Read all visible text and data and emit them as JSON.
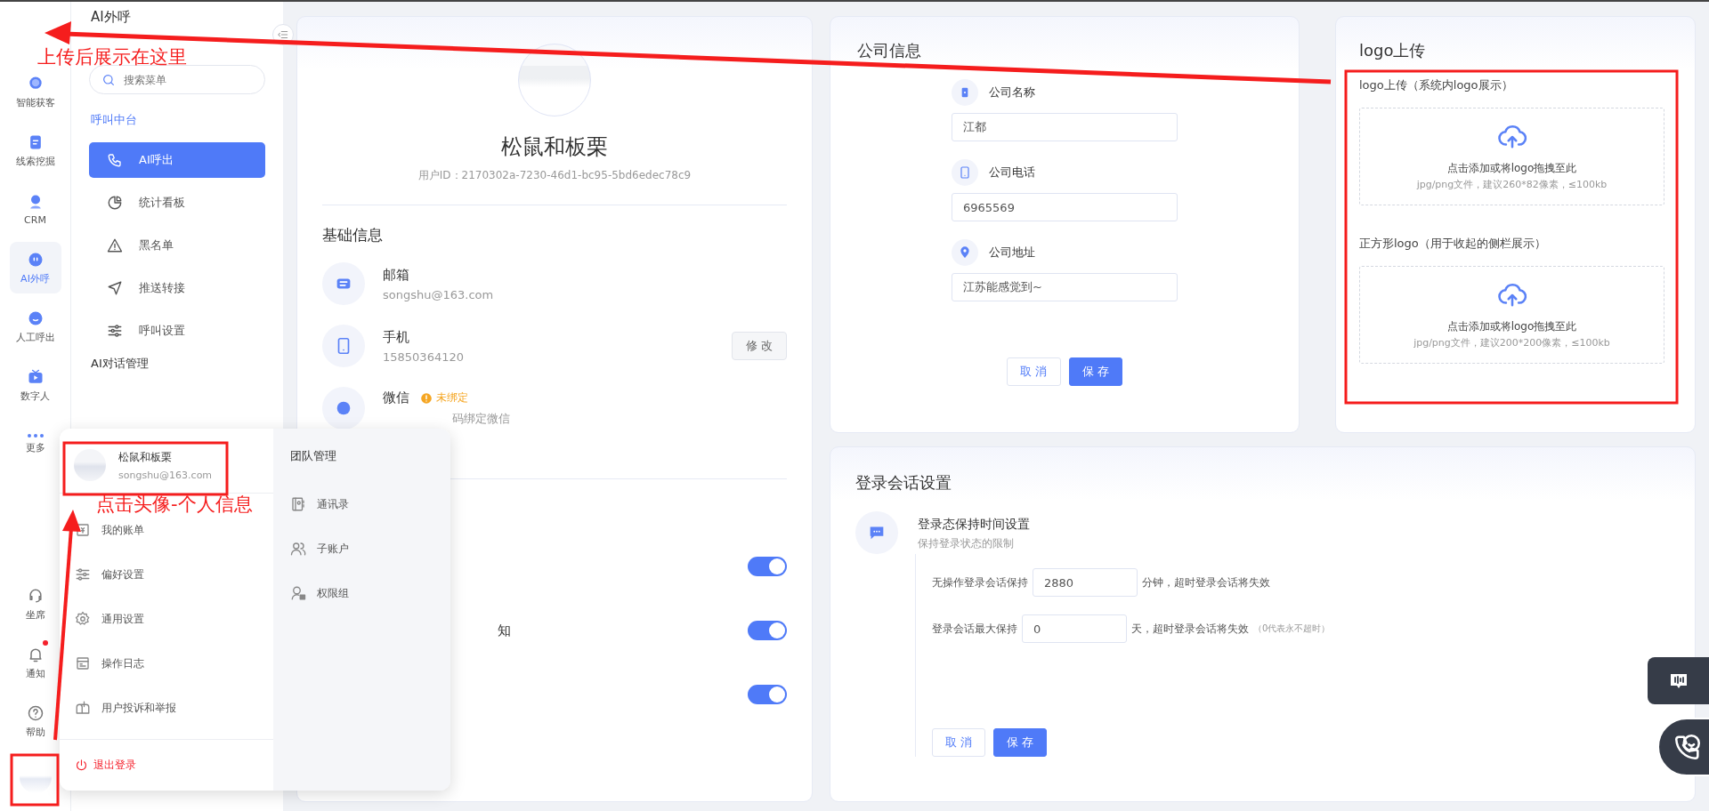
{
  "nav": {
    "items": [
      {
        "label": "智能获客",
        "selected": false
      },
      {
        "label": "线索挖掘",
        "selected": false
      },
      {
        "label": "CRM",
        "selected": false
      },
      {
        "label": "AI外呼",
        "selected": true
      },
      {
        "label": "人工呼出",
        "selected": false
      },
      {
        "label": "数字人",
        "selected": false
      },
      {
        "label": "更多",
        "selected": false
      }
    ],
    "bottom_items": [
      {
        "label": "坐席",
        "badge": false
      },
      {
        "label": "通知",
        "badge": true
      },
      {
        "label": "帮助",
        "badge": false
      }
    ]
  },
  "sidebar": {
    "title": "AI外呼",
    "search": {
      "placeholder": "搜索菜单"
    },
    "groups": [
      {
        "label": "呼叫中台",
        "items": [
          {
            "label": "AI呼出",
            "selected": true
          },
          {
            "label": "统计看板",
            "selected": false
          },
          {
            "label": "黑名单",
            "selected": false
          },
          {
            "label": "推送转接",
            "selected": false
          },
          {
            "label": "呼叫设置",
            "selected": false
          }
        ]
      },
      {
        "label": "AI对话管理"
      }
    ]
  },
  "profile_card": {
    "name": "松鼠和板栗",
    "user_id": "用户ID：2170302a-7230-46d1-bc95-5bd6edec78c9",
    "section_title": "基础信息",
    "fields": [
      {
        "label": "邮箱",
        "value": "songshu@163.com"
      },
      {
        "label": "手机",
        "value": "15850364120",
        "button": "修 改"
      },
      {
        "label": "微信",
        "badge": "未绑定",
        "value": "码绑定微信"
      }
    ],
    "toggles": [
      {
        "on": true
      },
      {
        "label": "知",
        "on": true
      },
      {
        "on": true
      }
    ]
  },
  "user_menu": {
    "name": "松鼠和板栗",
    "email": "songshu@163.com",
    "items": [
      "我的账单",
      "偏好设置",
      "通用设置",
      "操作日志",
      "用户投诉和举报"
    ],
    "logout": "退出登录",
    "team": {
      "title": "团队管理",
      "items": [
        "通讯录",
        "子账户",
        "权限组"
      ]
    }
  },
  "company_info": {
    "title": "公司信息",
    "fields": [
      {
        "label": "公司名称",
        "value": "江都"
      },
      {
        "label": "公司电话",
        "value": "6965569"
      },
      {
        "label": "公司地址",
        "value": "江苏能感觉到~"
      }
    ],
    "buttons": [
      "取 消",
      "保 存"
    ]
  },
  "logo_upload": {
    "title": "logo上传",
    "uploads": [
      {
        "label": "logo上传（系统内logo展示）",
        "prompt": "点击添加或将logo拖拽至此",
        "hint": "jpg/png文件，建议260*82像素，≤100kb"
      },
      {
        "label": "正方形logo（用于收起的侧栏展示）",
        "prompt": "点击添加或将logo拖拽至此",
        "hint": "jpg/png文件，建议200*200像素，≤100kb"
      }
    ]
  },
  "session_settings": {
    "title": "登录会话设置",
    "item_title": "登录态保持时间设置",
    "item_subtitle": "保持登录状态的限制",
    "rows": [
      {
        "label": "无操作登录会话保持",
        "value": "2880",
        "unit": "分钟，超时登录会话将失效"
      },
      {
        "label": "登录会话最大保持",
        "value": "0",
        "unit": "天，超时登录会话将失效",
        "note": "（0代表永不超时）"
      }
    ],
    "buttons": [
      "取 消",
      "保 存"
    ]
  },
  "annotations": [
    {
      "text": "上传后展示在这里"
    },
    {
      "text": "点击头像-个人信息"
    }
  ]
}
